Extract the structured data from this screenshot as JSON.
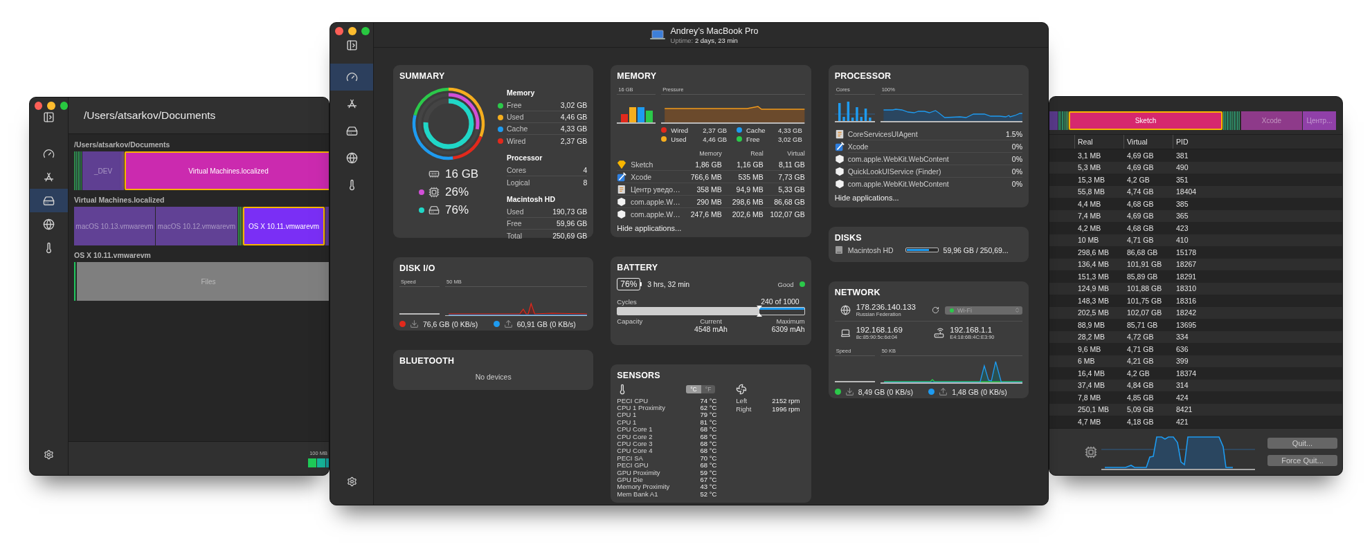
{
  "left_window": {
    "title": "/Users/atsarkov/Documents",
    "sidebar": [
      {
        "selected": false
      },
      {
        "selected": false
      },
      {
        "selected": true
      },
      {
        "selected": false
      },
      {
        "selected": false
      }
    ],
    "sections": [
      {
        "title": "/Users/atsarkov/Documents",
        "blocks": [
          {
            "kind": "stripes",
            "color": "#2f8a4a"
          },
          {
            "kind": "block",
            "label": "_DEV",
            "color": "#5f3f92",
            "selected": false
          },
          {
            "kind": "block",
            "label": "Virtual Machines.localized",
            "color": "#cb2aaf",
            "selected": true
          }
        ]
      },
      {
        "title": "Virtual Machines.localized",
        "blocks": [
          {
            "kind": "block",
            "label": "macOS 10.13.vmwarevm",
            "color": "#614195",
            "selected": false
          },
          {
            "kind": "block",
            "label": "macOS 10.12.vmwarevm",
            "color": "#614195",
            "selected": false
          },
          {
            "kind": "stripes",
            "color": "#2f8a4a"
          },
          {
            "kind": "block",
            "label": "OS X 10.11.vmwarevm",
            "color": "#7a2ff5",
            "selected": true
          },
          {
            "kind": "block",
            "color": "#5a3b8c",
            "selected": false
          }
        ]
      },
      {
        "title": "OS X 10.11.vmwarevm",
        "blocks": [
          {
            "kind": "stripes",
            "color": "#22c55e"
          },
          {
            "kind": "block",
            "label": "Files",
            "color": "#7f7f7f",
            "selected": false
          }
        ]
      }
    ],
    "footer": {
      "scale_label": "100 MB"
    }
  },
  "main_window": {
    "title": "Andrey’s MacBook Pro",
    "uptime_label": "Uptime:",
    "uptime": "2 days, 23 min",
    "sidebar": [
      {
        "selected": true
      },
      {
        "selected": false
      },
      {
        "selected": false
      },
      {
        "selected": false
      },
      {
        "selected": false
      }
    ],
    "summary": {
      "title": "SUMMARY",
      "stats": [
        {
          "value": "16 GB"
        },
        {
          "value": "26%",
          "color": "#d24fd8"
        },
        {
          "value": "76%",
          "color": "#20d7c7"
        }
      ],
      "groups": [
        {
          "title": "Memory",
          "rows": [
            {
              "label": "Free",
              "value": "3,02 GB",
              "color": "#2bc94a"
            },
            {
              "label": "Used",
              "value": "4,46 GB",
              "color": "#f5ae1e"
            },
            {
              "label": "Cache",
              "value": "4,33 GB",
              "color": "#1e9bf0"
            },
            {
              "label": "Wired",
              "value": "2,37 GB",
              "color": "#e2291c"
            }
          ]
        },
        {
          "title": "Processor",
          "rows": [
            {
              "label": "Cores",
              "value": "4"
            },
            {
              "label": "Logical",
              "value": "8"
            }
          ]
        },
        {
          "title": "Macintosh HD",
          "rows": [
            {
              "label": "Used",
              "value": "190,73 GB"
            },
            {
              "label": "Free",
              "value": "59,96 GB"
            },
            {
              "label": "Total",
              "value": "250,69 GB"
            }
          ]
        }
      ]
    },
    "disk_io": {
      "title": "DISK I/O",
      "speed_label": "Speed",
      "scale_label": "50 MB",
      "legend": [
        {
          "kind": "download",
          "color": "#e2291c",
          "value": "76,6 GB (0 KB/s)"
        },
        {
          "kind": "upload",
          "color": "#1e9bf0",
          "value": "60,91 GB (0 KB/s)"
        }
      ]
    },
    "bluetooth": {
      "title": "BLUETOOTH",
      "empty": "No devices"
    },
    "memory": {
      "title": "MEMORY",
      "total_label": "16 GB",
      "pressure_label": "Pressure",
      "legend": [
        {
          "label": "Wired",
          "value": "2,37 GB",
          "color": "#e2291c"
        },
        {
          "label": "Cache",
          "value": "4,33 GB",
          "color": "#1e9bf0"
        },
        {
          "label": "Used",
          "value": "4,46 GB",
          "color": "#f5ae1e"
        },
        {
          "label": "Free",
          "value": "3,02 GB",
          "color": "#2bc94a"
        }
      ],
      "columns": [
        "Memory",
        "Real",
        "Virtual"
      ],
      "apps": [
        {
          "name": "Sketch",
          "values": [
            "1,86 GB",
            "1,16 GB",
            "8,11 GB"
          ]
        },
        {
          "name": "Xcode",
          "values": [
            "766,6 MB",
            "535 MB",
            "7,73 GB"
          ]
        },
        {
          "name": "Центр уведо…",
          "values": [
            "358 MB",
            "94,9 MB",
            "5,33 GB"
          ]
        },
        {
          "name": "com.apple.W…",
          "values": [
            "290 MB",
            "298,6 MB",
            "86,68 GB"
          ]
        },
        {
          "name": "com.apple.W…",
          "values": [
            "247,6 MB",
            "202,6 MB",
            "102,07 GB"
          ]
        }
      ],
      "hide_link": "Hide applications..."
    },
    "battery": {
      "title": "BATTERY",
      "percent": "76%",
      "time": "3 hrs, 32 min",
      "health": "Good",
      "cycles_label": "Cycles",
      "cycles": "240 of 1000",
      "level": 0.76,
      "capacity_label": "Capacity",
      "current_label": "Current",
      "current": "4548 mAh",
      "maximum_label": "Maximum",
      "maximum": "6309 mAh"
    },
    "sensors": {
      "title": "SENSORS",
      "units": [
        {
          "label": "°C",
          "selected": true
        },
        {
          "label": "°F",
          "selected": false
        }
      ],
      "temperatures": [
        {
          "name": "PECI CPU",
          "value": "74 °C"
        },
        {
          "name": "CPU 1 Proximity",
          "value": "62 °C"
        },
        {
          "name": "CPU 1",
          "value": "79 °C"
        },
        {
          "name": "CPU 1",
          "value": "81 °C"
        },
        {
          "name": "CPU Core 1",
          "value": "68 °C"
        },
        {
          "name": "CPU Core 2",
          "value": "68 °C"
        },
        {
          "name": "CPU Core 3",
          "value": "68 °C"
        },
        {
          "name": "CPU Core 4",
          "value": "68 °C"
        },
        {
          "name": "PECI SA",
          "value": "70 °C"
        },
        {
          "name": "PECI GPU",
          "value": "68 °C"
        },
        {
          "name": "GPU Proximity",
          "value": "59 °C"
        },
        {
          "name": "GPU Die",
          "value": "67 °C"
        },
        {
          "name": "Memory Proximity",
          "value": "43 °C"
        },
        {
          "name": "Mem Bank A1",
          "value": "52 °C"
        }
      ],
      "fans": [
        {
          "name": "Left",
          "value": "2152 rpm"
        },
        {
          "name": "Right",
          "value": "1996 rpm"
        }
      ]
    },
    "processor": {
      "title": "PROCESSOR",
      "cores_label": "Cores",
      "scale_label": "100%",
      "apps": [
        {
          "name": "CoreServicesUIAgent",
          "usage": "1.5%"
        },
        {
          "name": "Xcode",
          "usage": "0%"
        },
        {
          "name": "com.apple.WebKit.WebContent",
          "usage": "0%"
        },
        {
          "name": "QuickLookUIService (Finder)",
          "usage": "0%"
        },
        {
          "name": "com.apple.WebKit.WebContent",
          "usage": "0%"
        }
      ],
      "hide_link": "Hide applications..."
    },
    "disks": {
      "title": "DISKS",
      "items": [
        {
          "name": "Macintosh HD",
          "level": 0.74,
          "usage": "59,96 GB / 250,69..."
        }
      ]
    },
    "network": {
      "title": "NETWORK",
      "public_ip": "178.236.140.133",
      "location": "Russian Federation",
      "interface": "Wi-Fi",
      "local_ip": "192.168.1.69",
      "local_mac": "8c:85:90:5c:6d:04",
      "router_ip": "192.168.1.1",
      "router_mac": "E4:18:6B:4C:E3:90",
      "speed_label": "Speed",
      "scale_label": "50 KB",
      "legend": [
        {
          "kind": "download",
          "color": "#2bc94a",
          "value": "8,49 GB (0 KB/s)"
        },
        {
          "kind": "upload",
          "color": "#1e9bf0",
          "value": "1,48 GB (0 KB/s)"
        }
      ]
    }
  },
  "right_window": {
    "treemap": [
      {
        "kind": "block",
        "color": "#5a3b8c",
        "selected": false
      },
      {
        "kind": "stripes",
        "color": "#2f8a6a"
      },
      {
        "kind": "block",
        "label": "Sketch",
        "color": "#d6286e",
        "selected": true
      },
      {
        "kind": "stripes",
        "color": "#2f8a6a"
      },
      {
        "kind": "block",
        "label": "Xcode",
        "color": "#8e3a8a",
        "selected": false
      },
      {
        "kind": "block",
        "label": "Центр...",
        "color": "#9040a8",
        "selected": false
      }
    ],
    "columns": [
      "Real",
      "Virtual",
      "PID"
    ],
    "rows": [
      [
        "3,1 MB",
        "4,69 GB",
        "381"
      ],
      [
        "5,3 MB",
        "4,69 GB",
        "490"
      ],
      [
        "15,3 MB",
        "4,2 GB",
        "351"
      ],
      [
        "55,8 MB",
        "4,74 GB",
        "18404"
      ],
      [
        "4,4 MB",
        "4,68 GB",
        "385"
      ],
      [
        "7,4 MB",
        "4,69 GB",
        "365"
      ],
      [
        "4,2 MB",
        "4,68 GB",
        "423"
      ],
      [
        "10 MB",
        "4,71 GB",
        "410"
      ],
      [
        "298,6 MB",
        "86,68 GB",
        "15178"
      ],
      [
        "136,4 MB",
        "101,91 GB",
        "18267"
      ],
      [
        "151,3 MB",
        "85,89 GB",
        "18291"
      ],
      [
        "124,9 MB",
        "101,88 GB",
        "18310"
      ],
      [
        "148,3 MB",
        "101,75 GB",
        "18316"
      ],
      [
        "202,5 MB",
        "102,07 GB",
        "18242"
      ],
      [
        "88,9 MB",
        "85,71 GB",
        "13695"
      ],
      [
        "28,2 MB",
        "4,72 GB",
        "334"
      ],
      [
        "9,6 MB",
        "4,71 GB",
        "636"
      ],
      [
        "6 MB",
        "4,21 GB",
        "399"
      ],
      [
        "16,4 MB",
        "4,2 GB",
        "18374"
      ],
      [
        "37,4 MB",
        "4,84 GB",
        "314"
      ],
      [
        "7,8 MB",
        "4,85 GB",
        "424"
      ],
      [
        "250,1 MB",
        "5,09 GB",
        "8421"
      ],
      [
        "4,7 MB",
        "4,18 GB",
        "421"
      ]
    ],
    "buttons": [
      "Quit...",
      "Force Quit..."
    ]
  }
}
